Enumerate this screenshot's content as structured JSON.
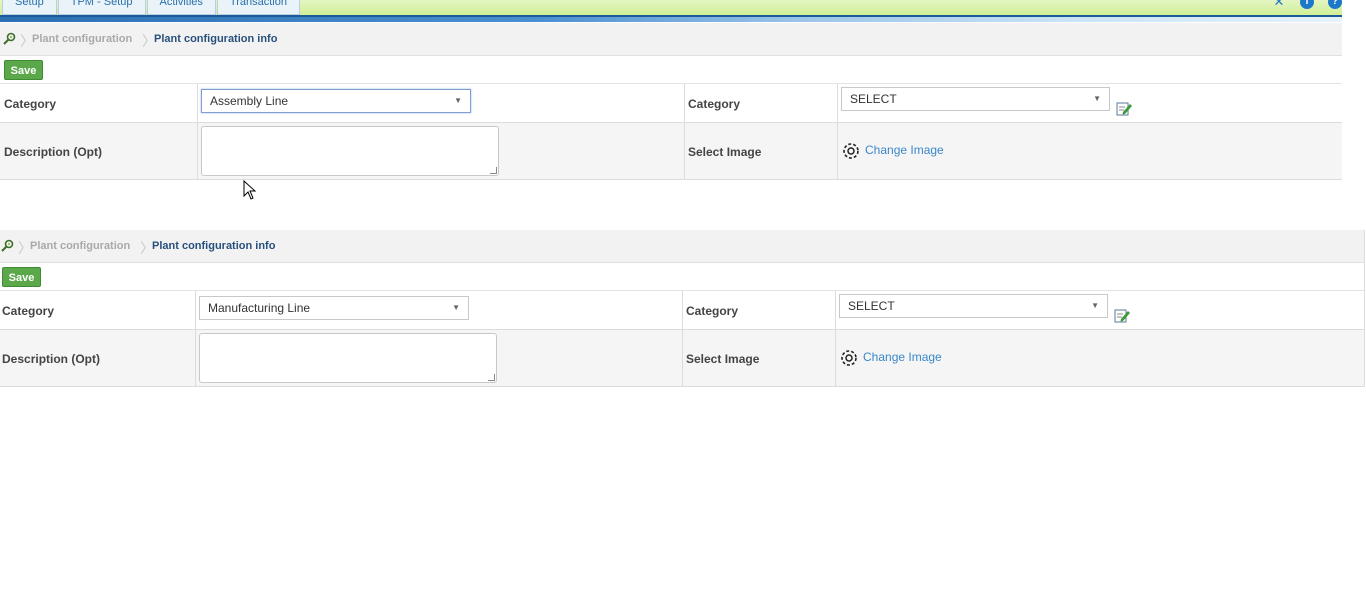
{
  "nav": {
    "tabs": [
      "Setup",
      "TPM - Setup",
      "Activities",
      "Transaction"
    ]
  },
  "panels": [
    {
      "breadcrumb": {
        "parent": "Plant configuration",
        "current": "Plant configuration info"
      },
      "save_label": "Save",
      "category_label": "Category",
      "category_value": "Assembly Line",
      "description_label": "Description (Opt)",
      "description_value": "",
      "right_category_label": "Category",
      "right_category_value": "SELECT",
      "select_image_label": "Select Image",
      "change_image_label": "Change Image"
    },
    {
      "breadcrumb": {
        "parent": "Plant configuration",
        "current": "Plant configuration info"
      },
      "save_label": "Save",
      "category_label": "Category",
      "category_value": "Manufacturing Line",
      "description_label": "Description (Opt)",
      "description_value": "",
      "right_category_label": "Category",
      "right_category_value": "SELECT",
      "select_image_label": "Select Image",
      "change_image_label": "Change Image"
    }
  ],
  "colors": {
    "save_button": "#5aa84a",
    "link": "#3a87c8",
    "breadcrumb_current": "#28507c",
    "nav_bar": "#d2ef9a"
  }
}
